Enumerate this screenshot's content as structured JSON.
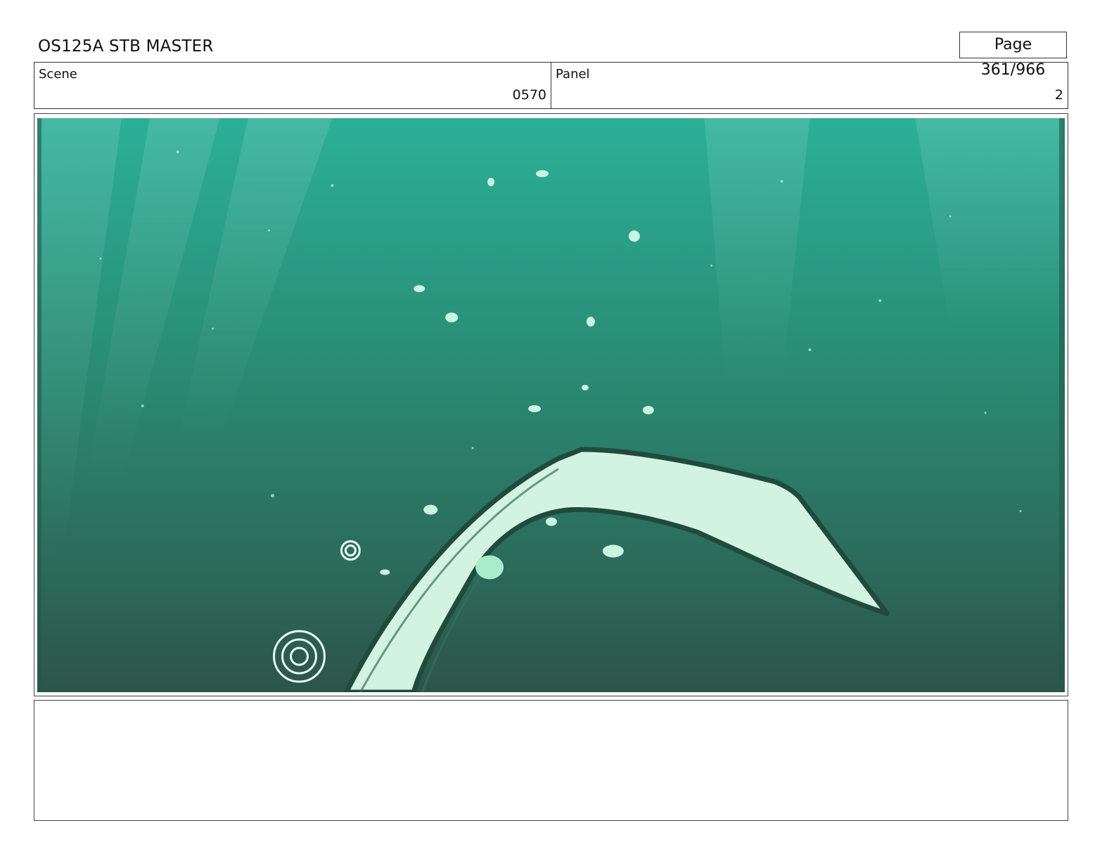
{
  "header": {
    "title": "OS125A STB MASTER",
    "page": "Page 361/966"
  },
  "info": {
    "scene_label": "Scene",
    "scene_value": "0570",
    "panel_label": "Panel",
    "panel_value": "2"
  },
  "panel_image": {
    "water_top_color": "#2bb097",
    "water_bottom_color": "#2d5549",
    "tail_fill_color": "#d3f3e2",
    "bubble_color": "#c9f4e0"
  },
  "notes": {
    "text": ""
  }
}
